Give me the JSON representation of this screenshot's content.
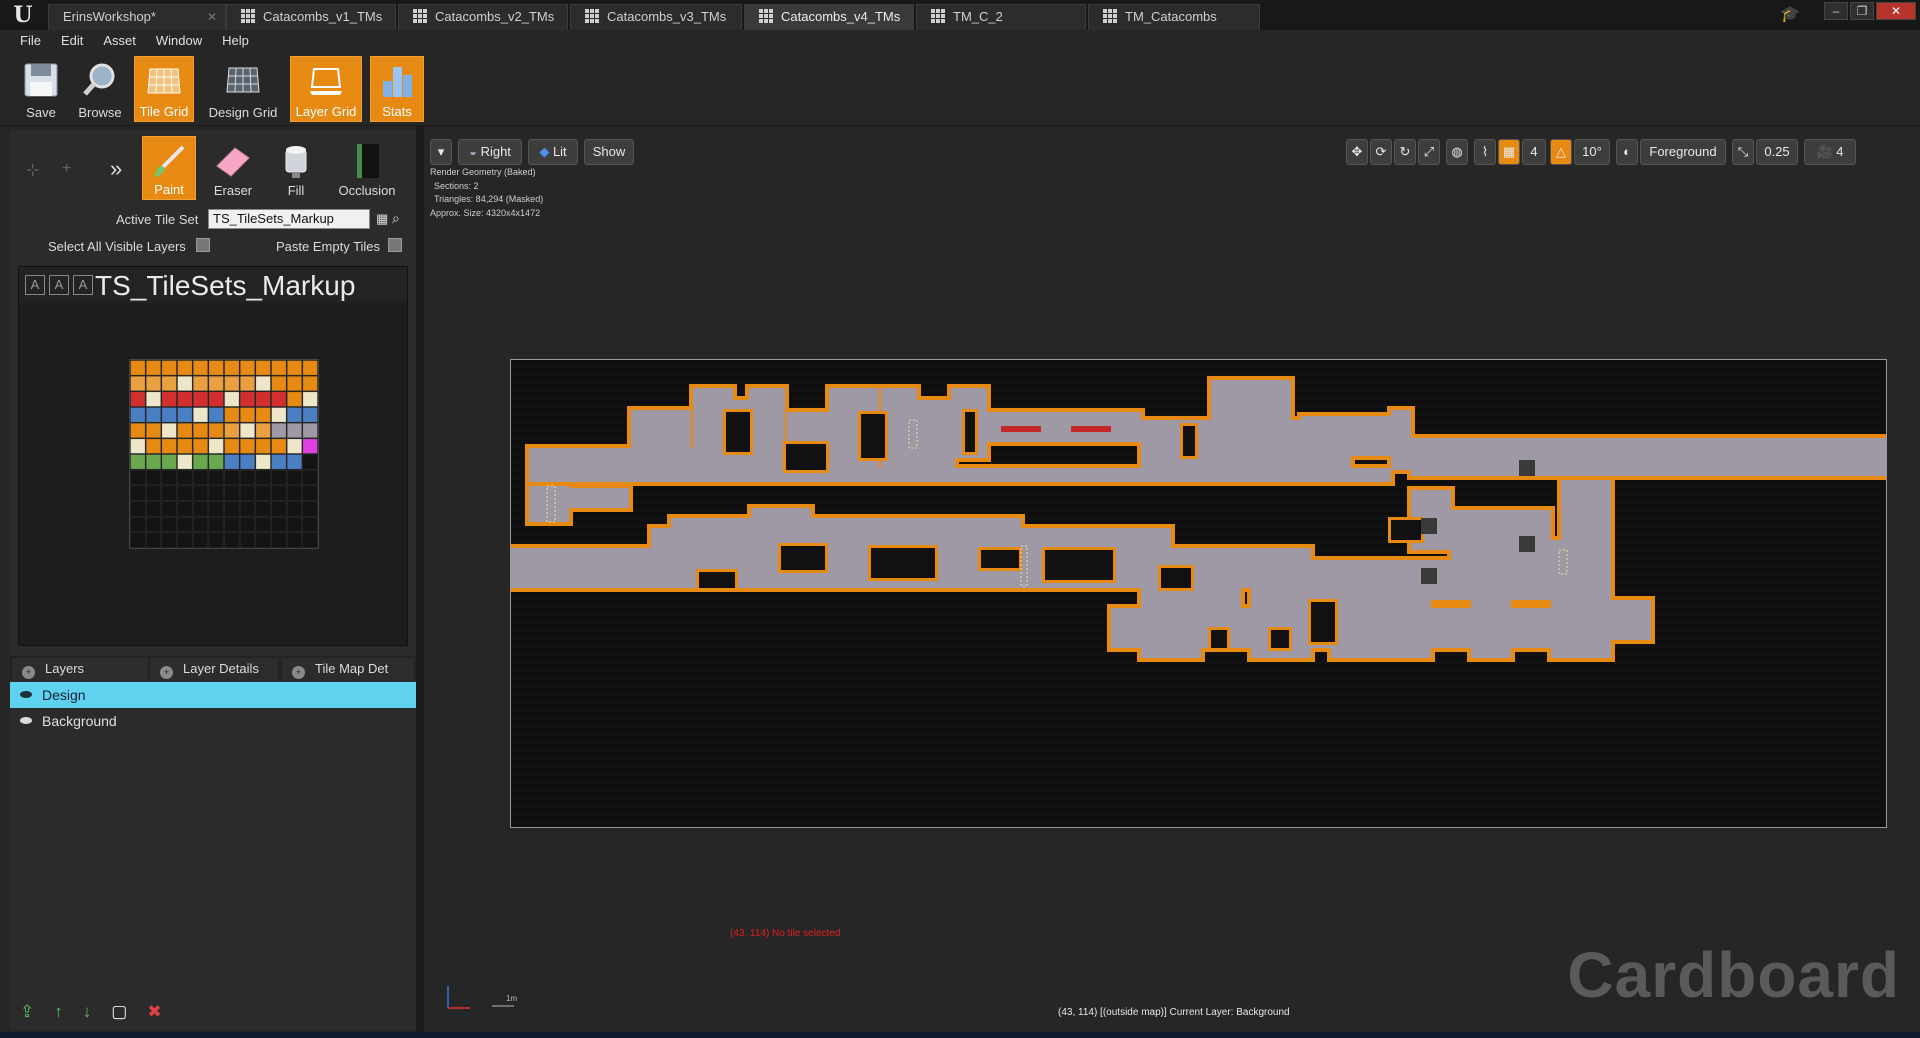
{
  "window": {
    "tabs": [
      {
        "label": "ErinsWorkshop*",
        "active": false
      },
      {
        "label": "Catacombs_v1_TMs",
        "active": false
      },
      {
        "label": "Catacombs_v2_TMs",
        "active": false
      },
      {
        "label": "Catacombs_v3_TMs",
        "active": false
      },
      {
        "label": "Catacombs_v4_TMs",
        "active": true
      },
      {
        "label": "TM_C_2",
        "active": false
      },
      {
        "label": "TM_Catacombs",
        "active": false
      }
    ]
  },
  "menu": {
    "items": [
      "File",
      "Edit",
      "Asset",
      "Window",
      "Help"
    ]
  },
  "toolbar": {
    "save": "Save",
    "browse": "Browse",
    "tile_grid": "Tile Grid",
    "design_grid": "Design Grid",
    "layer_grid": "Layer Grid",
    "stats": "Stats"
  },
  "tools": {
    "paint": "Paint",
    "eraser": "Eraser",
    "fill": "Fill",
    "occlusion": "Occlusion"
  },
  "tileset": {
    "active_label": "Active Tile Set",
    "active_value": "TS_TileSets_Markup",
    "select_all_visible": "Select All Visible Layers",
    "paste_empty": "Paste Empty Tiles",
    "title": "TS_TileSets_Markup",
    "header_glyphs": [
      "A",
      "A",
      "A"
    ]
  },
  "layers": {
    "tabs": [
      "Layers",
      "Layer Details",
      "Tile Map Det"
    ],
    "items": [
      {
        "name": "Design",
        "selected": true
      },
      {
        "name": "Background",
        "selected": false
      }
    ]
  },
  "viewport": {
    "view_mode": "Right",
    "lighting": "Lit",
    "show": "Show",
    "grid_snap": "4",
    "rotation_snap": "10°",
    "layer": "Foreground",
    "scale_snap": "0.25",
    "camera_speed": "4",
    "render_info": [
      "Render Geometry (Baked)",
      "Sections: 2",
      "Triangles: 84,294 (Masked)",
      "Approx. Size: 4320x4x1472"
    ],
    "status_red": "(43, 114) No tile selected",
    "status": "(43, 114) [(outside map)]   Current Layer: Background",
    "scale_label": "1m",
    "watermark": "Cardboard"
  },
  "colors": {
    "accent": "#e68a14",
    "selection": "#5ed2ef",
    "floor": "#9e99a5",
    "wall": "#e68a14",
    "hazard": "#c62828"
  }
}
